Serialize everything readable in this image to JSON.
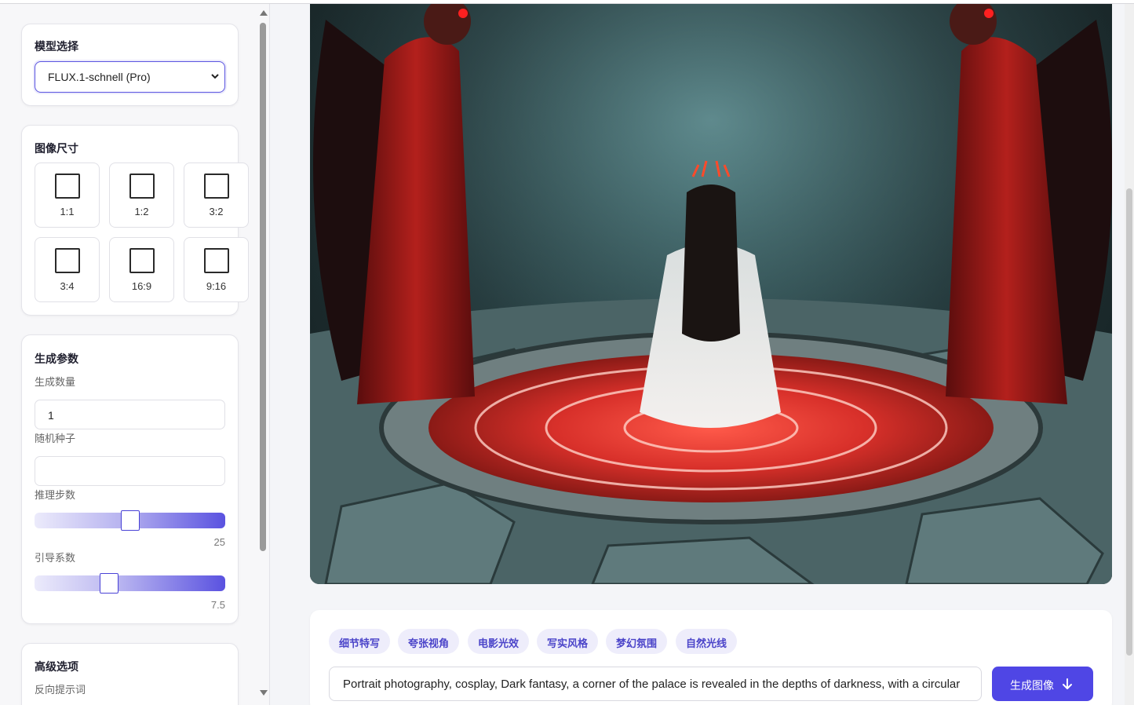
{
  "sidebar": {
    "model": {
      "title": "模型选择",
      "selected": "FLUX.1-schnell (Pro)"
    },
    "size": {
      "title": "图像尺寸",
      "ratios": [
        "1:1",
        "1:2",
        "3:2",
        "3:4",
        "16:9",
        "9:16"
      ]
    },
    "params": {
      "title": "生成参数",
      "count_label": "生成数量",
      "count_value": "1",
      "seed_label": "随机种子",
      "seed_value": "",
      "steps_label": "推理步数",
      "steps_value": "25",
      "steps_fraction": 0.5,
      "guidance_label": "引导系数",
      "guidance_value": "7.5",
      "guidance_fraction": 0.38
    },
    "advanced": {
      "title": "高级选项",
      "negative_label": "反向提示词"
    }
  },
  "main": {
    "tags": [
      "细节特写",
      "夸张视角",
      "电影光效",
      "写实风格",
      "梦幻氛围",
      "自然光线"
    ],
    "prompt": "Portrait photography, cosplay, Dark fantasy, a corner of the palace is revealed in the depths of darkness, with a circular",
    "generate_label": "生成图像"
  },
  "colors": {
    "accent": "#4f46e5",
    "tag_bg": "#eeedfb",
    "tag_text": "#4b44c9"
  },
  "icons": {
    "select": "chevron-down-icon",
    "generate": "arrow-down-icon",
    "ratio": "square-icon"
  }
}
